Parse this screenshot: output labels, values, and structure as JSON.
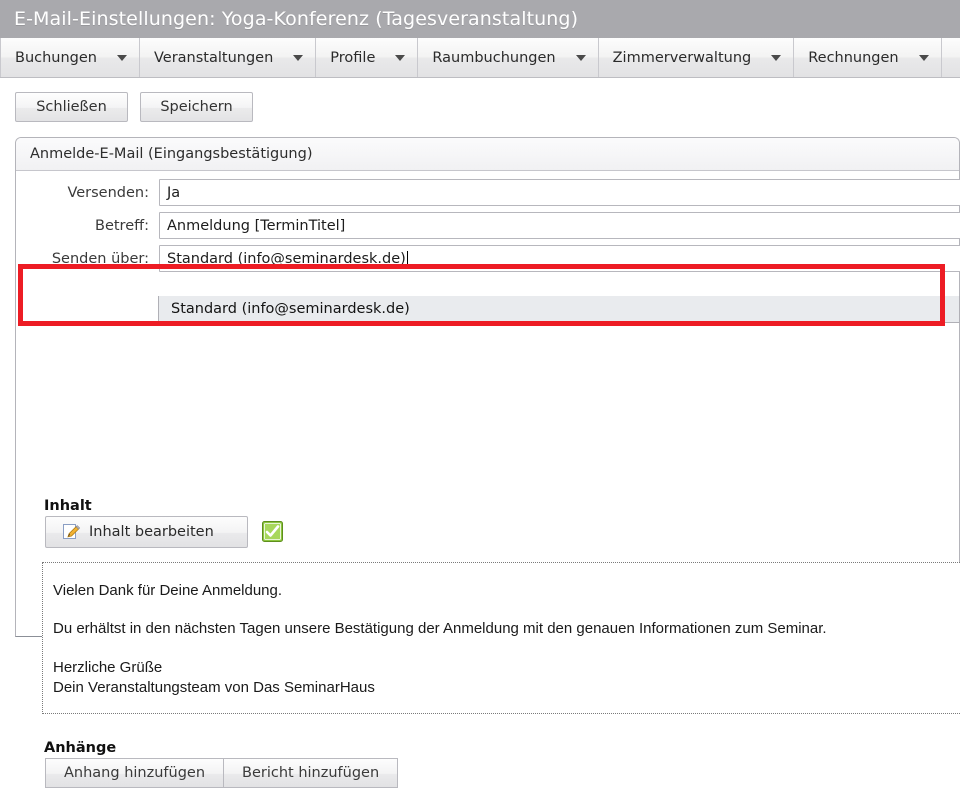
{
  "window": {
    "title": "E-Mail-Einstellungen: Yoga-Konferenz (Tagesveranstaltung)"
  },
  "menubar": {
    "items": [
      {
        "label": "Buchungen",
        "icon": "chevron-down-icon"
      },
      {
        "label": "Veranstaltungen",
        "icon": "chevron-down-icon"
      },
      {
        "label": "Profile",
        "icon": "chevron-down-icon"
      },
      {
        "label": "Raumbuchungen",
        "icon": "chevron-down-icon"
      },
      {
        "label": "Zimmerverwaltung",
        "icon": "chevron-down-icon"
      },
      {
        "label": "Rechnungen",
        "icon": "chevron-down-icon"
      }
    ]
  },
  "toolbar": {
    "close_label": "Schließen",
    "save_label": "Speichern"
  },
  "panel": {
    "header": "Anmelde-E-Mail (Eingangsbestätigung)"
  },
  "form": {
    "versenden": {
      "label": "Versenden:",
      "value": "Ja"
    },
    "betreff": {
      "label": "Betreff:",
      "value": "Anmeldung [TerminTitel]"
    },
    "senden_ueber": {
      "label": "Senden über:",
      "value": "Standard (info@seminardesk.de)",
      "open": true,
      "options": [
        "Standard (info@seminardesk.de)"
      ]
    }
  },
  "highlight": {
    "color": "#ed1c24"
  },
  "inhalt": {
    "section_label": "Inhalt",
    "edit_button_label": "Inhalt bearbeiten",
    "edit_button_icon": "page-pencil-icon",
    "status_icon": "green-check-icon",
    "status_color": "#76b72a",
    "preview": {
      "line1": "Vielen Dank für Deine Anmeldung.",
      "line2": "Du erhältst in den nächsten Tagen unsere Bestätigung der Anmeldung mit den genauen Informationen zum Seminar.",
      "line3": "Herzliche Grüße",
      "line4": "Dein Veranstaltungsteam von Das SeminarHaus"
    }
  },
  "anhaenge": {
    "section_label": "Anhänge",
    "add_attachment_label": "Anhang hinzufügen",
    "add_report_label": "Bericht hinzufügen"
  }
}
